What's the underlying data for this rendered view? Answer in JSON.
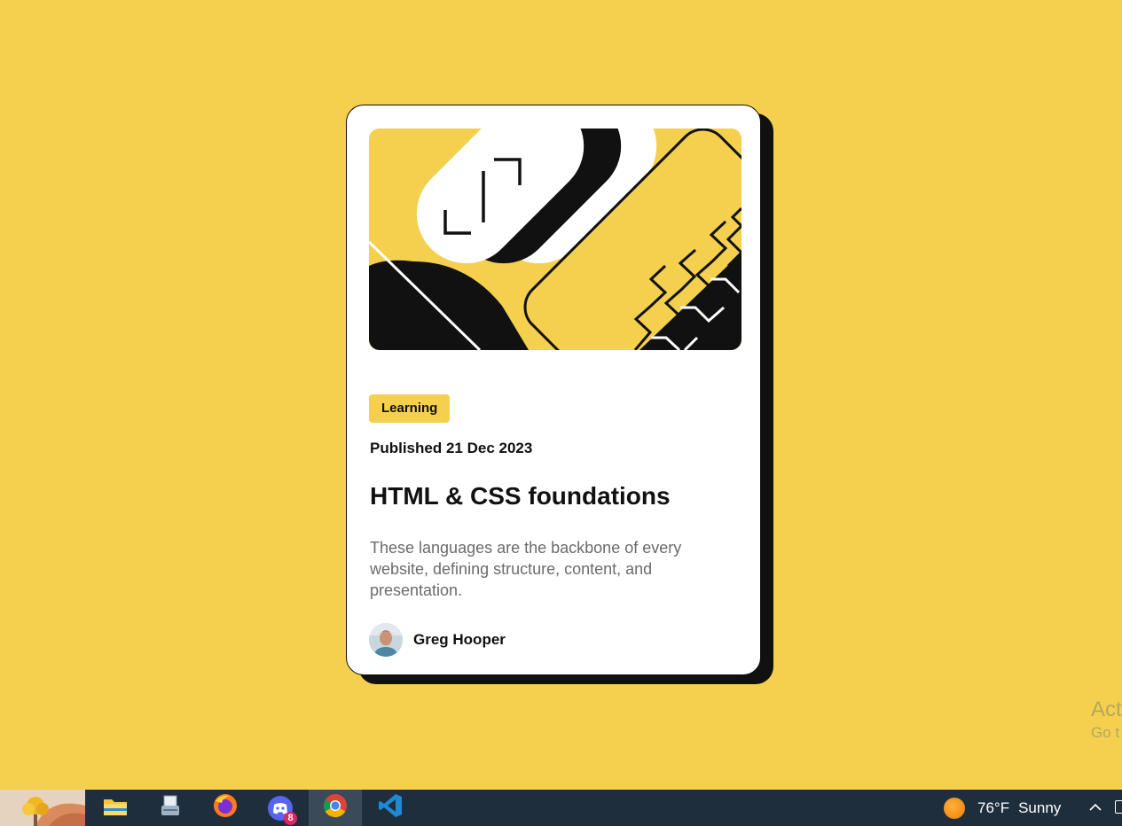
{
  "card": {
    "tag": "Learning",
    "published": "Published 21 Dec 2023",
    "title": "HTML & CSS foundations",
    "description": "These languages are the backbone of every website, defining structure, content, and presentation.",
    "author": "Greg Hooper"
  },
  "watermark": {
    "line1": "Act",
    "line2": "Go t"
  },
  "taskbar": {
    "apps": [
      "file-explorer",
      "scanner",
      "firefox",
      "discord",
      "chrome",
      "vscode"
    ],
    "active_app": "chrome",
    "discord_badge": "8",
    "weather_temp": "76°F",
    "weather_condition": "Sunny"
  },
  "colors": {
    "background": "#f4d04e",
    "card": "#ffffff",
    "ink": "#111111",
    "text_muted": "#6b6b6b"
  }
}
